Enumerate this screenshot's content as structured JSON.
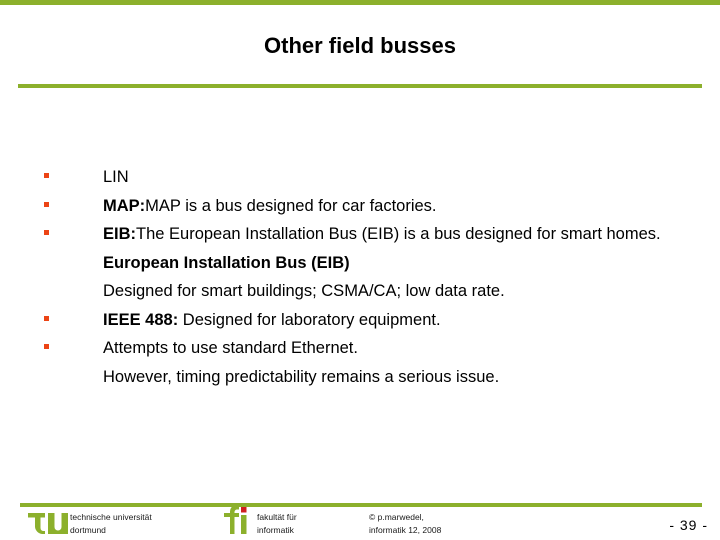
{
  "slide": {
    "title": "Other field busses",
    "accent_color": "#8cb02c",
    "bullet_color": "#ec4415",
    "bullets": [
      {
        "lead": "",
        "rest": "LIN"
      },
      {
        "lead": "MAP:",
        "rest": "MAP is a bus designed for car factories."
      },
      {
        "lead": "EIB:",
        "rest": "The European Installation Bus (EIB) is a bus designed for smart homes. ",
        "lead2": "European Installation Bus (EIB)",
        "rest2": "\nDesigned for smart buildings; CSMA/CA; low data rate."
      },
      {
        "lead": "IEEE 488:",
        "rest": " Designed for laboratory equipment."
      },
      {
        "lead": "",
        "rest": "Attempts to use standard Ethernet.\nHowever, timing predictability remains a serious issue."
      }
    ]
  },
  "footer": {
    "university_line1": "technische universität",
    "university_line2": "dortmund",
    "faculty_line1": "fakultät für",
    "faculty_line2": "informatik",
    "copyright_line1": "© p.marwedel,",
    "copyright_line2": "informatik 12,  2008",
    "page_number": "-  39 -",
    "logo_tu_text": "tu",
    "logo_fi_text": "fi"
  }
}
